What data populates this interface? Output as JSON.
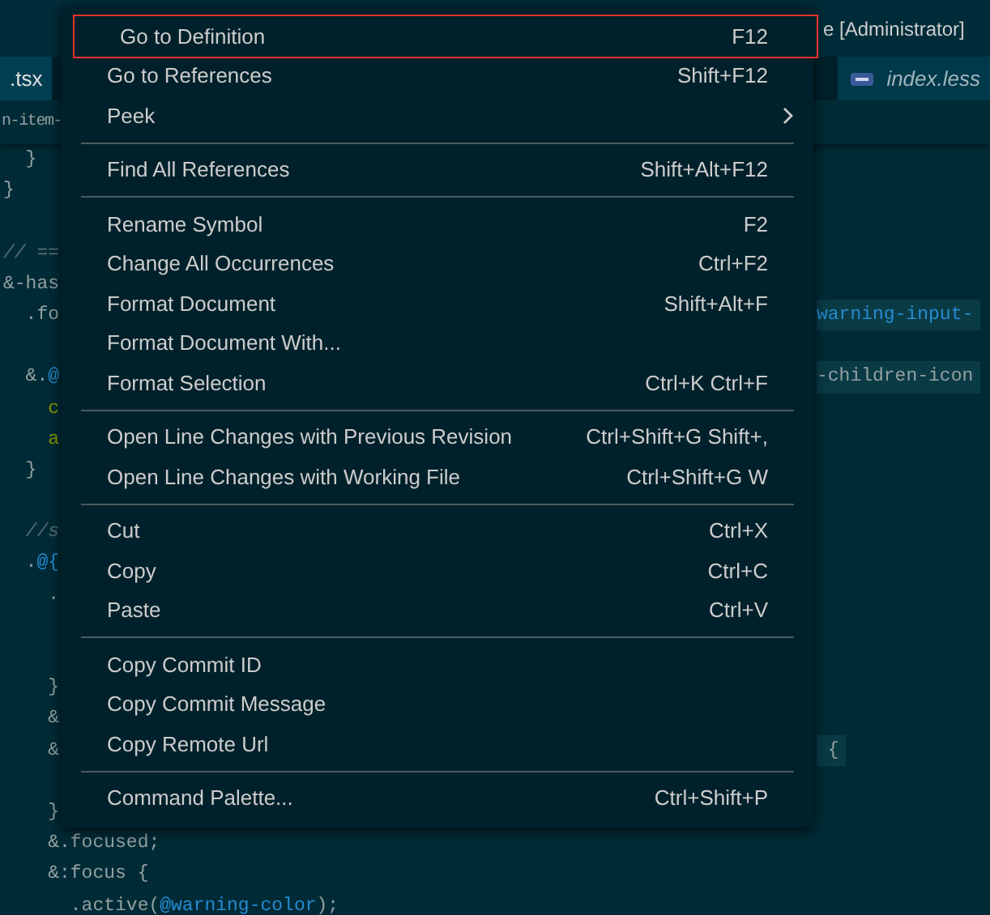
{
  "title_bar": {
    "text": "e [Administrator]"
  },
  "tabs": [
    {
      "label": ".tsx",
      "selected": true
    },
    {
      "label": "index.less",
      "selected": false,
      "icon": true
    }
  ],
  "breadcrumb": {
    "text": "n-item-"
  },
  "code_lines": [
    {
      "kind": "code",
      "left": [
        {
          "text": "  }",
          "kind": "plain"
        }
      ]
    },
    {
      "kind": "code",
      "left": [
        {
          "text": "}",
          "kind": "plain"
        }
      ]
    },
    {
      "kind": "blank"
    },
    {
      "kind": "code",
      "left": [
        {
          "text": "// ==",
          "kind": "comment"
        }
      ]
    },
    {
      "kind": "code",
      "left": [
        {
          "text": "&-has",
          "kind": "plain"
        }
      ]
    },
    {
      "kind": "code",
      "left": [
        {
          "text": "  .fo",
          "kind": "plain"
        }
      ],
      "right": [
        {
          "text": "warning-input-",
          "kind": "variable"
        }
      ]
    },
    {
      "kind": "blank"
    },
    {
      "kind": "code",
      "left": [
        {
          "text": "  &.",
          "kind": "plain"
        },
        {
          "text": "@",
          "kind": "variable"
        }
      ],
      "right": [
        {
          "text": "-children-icon",
          "kind": "plain"
        }
      ]
    },
    {
      "kind": "code",
      "left": [
        {
          "text": "    c",
          "kind": "property"
        }
      ]
    },
    {
      "kind": "code",
      "left": [
        {
          "text": "    a",
          "kind": "property"
        }
      ]
    },
    {
      "kind": "code",
      "left": [
        {
          "text": "  }",
          "kind": "plain"
        }
      ]
    },
    {
      "kind": "blank"
    },
    {
      "kind": "code",
      "left": [
        {
          "text": "  //s",
          "kind": "comment"
        }
      ]
    },
    {
      "kind": "code",
      "left": [
        {
          "text": "  .",
          "kind": "plain"
        },
        {
          "text": "@{",
          "kind": "variable"
        }
      ]
    },
    {
      "kind": "code",
      "left": [
        {
          "text": "    .",
          "kind": "plain"
        }
      ]
    },
    {
      "kind": "blank"
    },
    {
      "kind": "blank"
    },
    {
      "kind": "code",
      "left": [
        {
          "text": "    }",
          "kind": "plain"
        }
      ]
    },
    {
      "kind": "code",
      "left": [
        {
          "text": "    &",
          "kind": "plain"
        }
      ]
    },
    {
      "kind": "code",
      "left": [
        {
          "text": "    &",
          "kind": "plain"
        }
      ],
      "right": [
        {
          "text": " {",
          "kind": "plain"
        }
      ]
    },
    {
      "kind": "blank"
    },
    {
      "kind": "code",
      "left": [
        {
          "text": "    }",
          "kind": "plain"
        }
      ]
    },
    {
      "kind": "code",
      "left": [
        {
          "text": "    &.focused;",
          "kind": "plain"
        }
      ]
    },
    {
      "kind": "code",
      "left": [
        {
          "text": "    &:focus {",
          "kind": "plain"
        }
      ]
    },
    {
      "kind": "code",
      "left": [
        {
          "text": "      .active(",
          "kind": "plain"
        },
        {
          "text": "@warning-color",
          "kind": "variable"
        },
        {
          "text": ");",
          "kind": "plain"
        }
      ]
    }
  ],
  "context_menu": {
    "groups": [
      [
        {
          "label": "Go to Definition",
          "shortcut": "F12",
          "selected": true,
          "submenu": false
        },
        {
          "label": "Go to References",
          "shortcut": "Shift+F12",
          "selected": false,
          "submenu": false
        },
        {
          "label": "Peek",
          "selected": false,
          "submenu": true
        }
      ],
      [
        {
          "label": "Find All References",
          "shortcut": "Shift+Alt+F12",
          "selected": false,
          "submenu": false
        }
      ],
      [
        {
          "label": "Rename Symbol",
          "shortcut": "F2",
          "selected": false,
          "submenu": false
        },
        {
          "label": "Change All Occurrences",
          "shortcut": "Ctrl+F2",
          "selected": false,
          "submenu": false
        },
        {
          "label": "Format Document",
          "shortcut": "Shift+Alt+F",
          "selected": false,
          "submenu": false
        },
        {
          "label": "Format Document With...",
          "selected": false,
          "submenu": false
        },
        {
          "label": "Format Selection",
          "shortcut": "Ctrl+K Ctrl+F",
          "selected": false,
          "submenu": false
        }
      ],
      [
        {
          "label": "Open Line Changes with Previous Revision",
          "shortcut": "Ctrl+Shift+G Shift+,",
          "selected": false,
          "submenu": false
        },
        {
          "label": "Open Line Changes with Working File",
          "shortcut": "Ctrl+Shift+G W",
          "selected": false,
          "submenu": false
        }
      ],
      [
        {
          "label": "Cut",
          "shortcut": "Ctrl+X",
          "selected": false,
          "submenu": false
        },
        {
          "label": "Copy",
          "shortcut": "Ctrl+C",
          "selected": false,
          "submenu": false
        },
        {
          "label": "Paste",
          "shortcut": "Ctrl+V",
          "selected": false,
          "submenu": false
        }
      ],
      [
        {
          "label": "Copy Commit ID",
          "selected": false,
          "submenu": false
        },
        {
          "label": "Copy Commit Message",
          "selected": false,
          "submenu": false
        },
        {
          "label": "Copy Remote Url",
          "selected": false,
          "submenu": false
        }
      ],
      [
        {
          "label": "Command Palette...",
          "shortcut": "Ctrl+Shift+P",
          "selected": false,
          "submenu": false
        }
      ]
    ]
  }
}
